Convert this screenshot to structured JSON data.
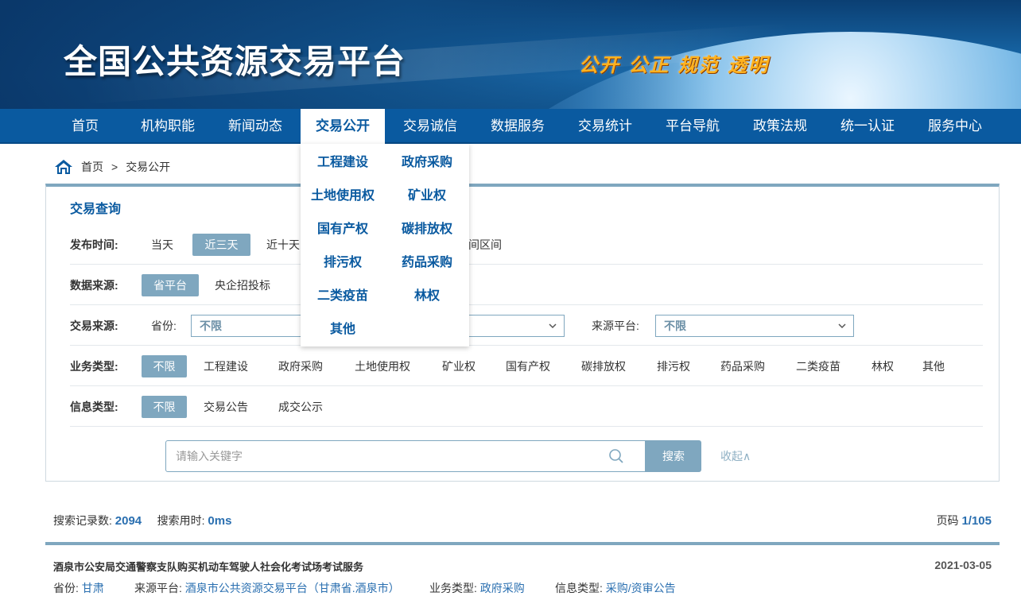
{
  "banner": {
    "site_title": "全国公共资源交易平台",
    "slogan": "公开 公正 规范 透明"
  },
  "nav": {
    "items": [
      "首页",
      "机构职能",
      "新闻动态",
      "交易公开",
      "交易诚信",
      "数据服务",
      "交易统计",
      "平台导航",
      "政策法规",
      "统一认证",
      "服务中心"
    ],
    "active": "交易公开"
  },
  "dropdown": {
    "items": [
      "工程建设",
      "政府采购",
      "土地使用权",
      "矿业权",
      "国有产权",
      "碳排放权",
      "排污权",
      "药品采购",
      "二类疫苗",
      "林权",
      "其他"
    ]
  },
  "breadcrumb": {
    "home": "首页",
    "separator": ">",
    "current": "交易公开"
  },
  "query": {
    "title": "交易查询",
    "publish_time": {
      "label": "发布时间:",
      "options": [
        "当天",
        "近三天",
        "近十天",
        "间区间"
      ],
      "selected": "近三天"
    },
    "data_source": {
      "label": "数据来源:",
      "options": [
        "省平台",
        "央企招投标"
      ],
      "selected": "省平台"
    },
    "trade_source": {
      "label": "交易来源:",
      "province_label": "省份:",
      "province_value": "不限",
      "platform_label": "来源平台:",
      "platform_value": "不限"
    },
    "business_type": {
      "label": "业务类型:",
      "options": [
        "不限",
        "工程建设",
        "政府采购",
        "土地使用权",
        "矿业权",
        "国有产权",
        "碳排放权",
        "排污权",
        "药品采购",
        "二类疫苗",
        "林权",
        "其他"
      ],
      "selected": "不限"
    },
    "info_type": {
      "label": "信息类型:",
      "options": [
        "不限",
        "交易公告",
        "成交公示"
      ],
      "selected": "不限"
    },
    "search": {
      "placeholder": "请输入关键字",
      "button": "搜索",
      "collapse": "收起∧"
    }
  },
  "results": {
    "count_label": "搜索记录数:",
    "count": "2094",
    "time_label": "搜索用时:",
    "time": "0ms",
    "page_label": "页码",
    "page": "1/105",
    "items": [
      {
        "title": "酒泉市公安局交通警察支队购买机动车驾驶人社会化考试场考试服务",
        "date": "2021-03-05",
        "province_label": "省份:",
        "province": "甘肃",
        "platform_label": "来源平台:",
        "platform": "酒泉市公共资源交易平台（甘肃省.酒泉市）",
        "business_label": "业务类型:",
        "business": "政府采购",
        "info_label": "信息类型:",
        "info": "采购/资审公告"
      }
    ]
  },
  "colors": {
    "nav_bg": "#0a5aa0",
    "accent": "#7fa7bf",
    "link": "#2a6fb0",
    "slogan": "#ffb21f"
  }
}
